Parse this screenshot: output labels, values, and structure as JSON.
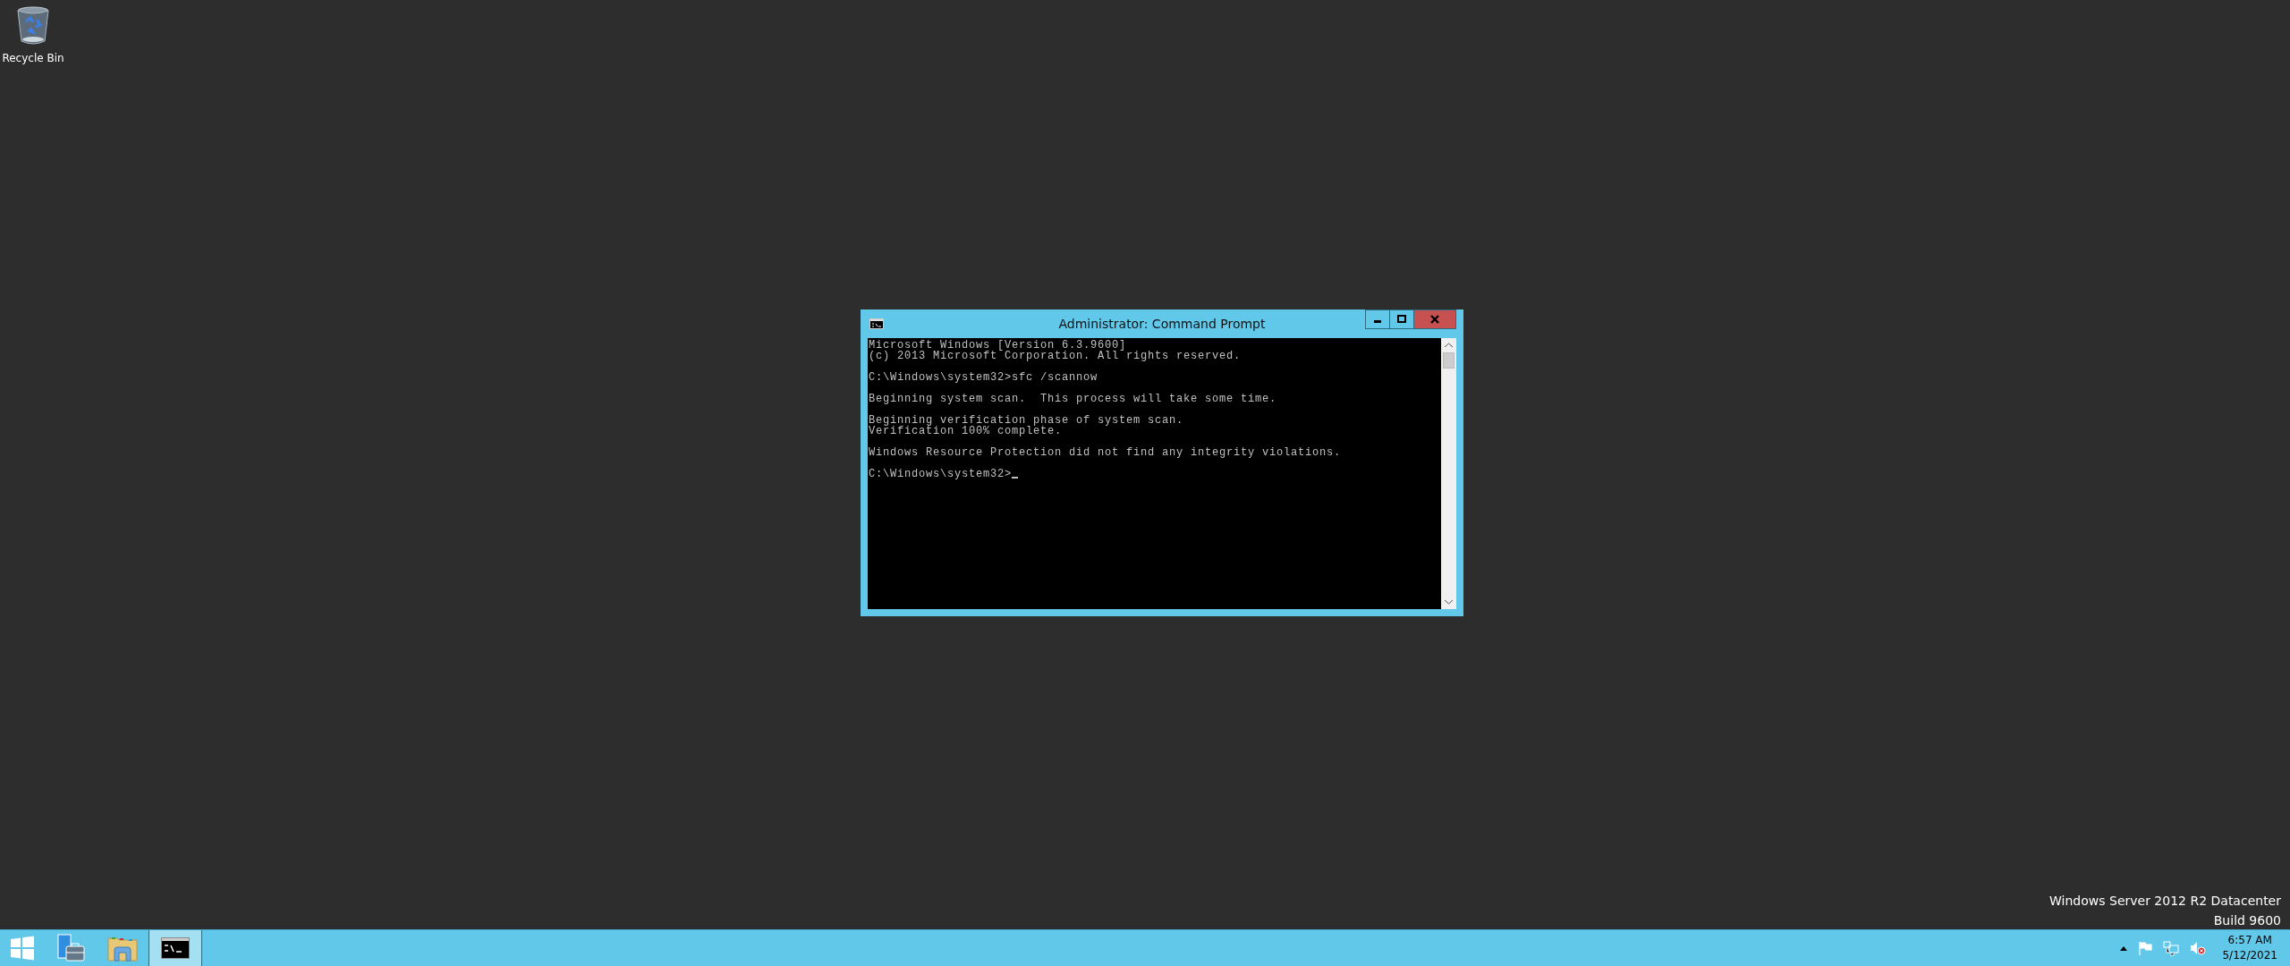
{
  "desktop_icons": [
    {
      "label": "Recycle Bin"
    }
  ],
  "window": {
    "title": "Administrator: Command Prompt",
    "console_paragraphs": [
      [
        "Microsoft Windows [Version 6.3.9600]",
        "(c) 2013 Microsoft Corporation. All rights reserved."
      ],
      [
        "C:\\Windows\\system32>sfc /scannow"
      ],
      [
        "Beginning system scan.  This process will take some time."
      ],
      [
        "Beginning verification phase of system scan.",
        "Verification 100% complete."
      ],
      [
        "Windows Resource Protection did not find any integrity violations."
      ],
      [
        "C:\\Windows\\system32>"
      ]
    ],
    "cursor": true
  },
  "os_edition": [
    "Windows Server 2012 R2 Datacenter",
    "Build 9600"
  ],
  "taskbar": {
    "apps": [
      {
        "kind": "server-manager",
        "selected": false
      },
      {
        "kind": "file-explorer",
        "selected": false
      },
      {
        "kind": "command-prompt",
        "selected": true
      }
    ],
    "clock": {
      "time": "6:57 AM",
      "date": "5/12/2021"
    }
  }
}
